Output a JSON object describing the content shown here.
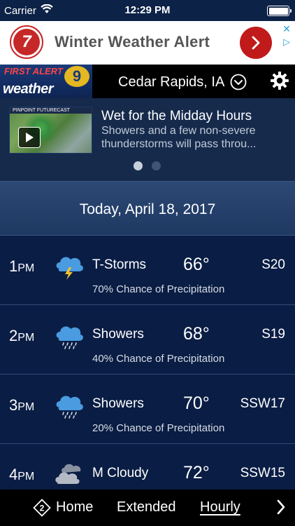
{
  "status_bar": {
    "carrier": "Carrier",
    "time": "12:29 PM"
  },
  "ad": {
    "logo_text": "7",
    "text": "Winter Weather Alert"
  },
  "header": {
    "brand_top": "FIRST ALERT",
    "brand_bottom": "weather",
    "brand_number": "9",
    "location": "Cedar Rapids, IA"
  },
  "news": {
    "title": "Wet for the Midday Hours",
    "body": "Showers and a few non-severe thunderstorms will pass throu...",
    "thumb_caption": "PINPOINT FUTURECAST"
  },
  "date_label": "Today, April 18, 2017",
  "hourly": [
    {
      "hour": "1",
      "period": "PM",
      "icon": "thunderstorm-icon",
      "condition": "T-Storms",
      "temp": "66°",
      "wind": "S20",
      "precip": "70% Chance of Precipitation"
    },
    {
      "hour": "2",
      "period": "PM",
      "icon": "rain-icon",
      "condition": "Showers",
      "temp": "68°",
      "wind": "S19",
      "precip": "40% Chance of Precipitation"
    },
    {
      "hour": "3",
      "period": "PM",
      "icon": "rain-icon",
      "condition": "Showers",
      "temp": "70°",
      "wind": "SSW17",
      "precip": "20% Chance of Precipitation"
    },
    {
      "hour": "4",
      "period": "PM",
      "icon": "cloudy-icon",
      "condition": "M Cloudy",
      "temp": "72°",
      "wind": "SSW15",
      "precip": ""
    }
  ],
  "nav": {
    "home": "Home",
    "extended": "Extended",
    "hourly": "Hourly",
    "home_badge": "2"
  },
  "colors": {
    "background": "#0b1c3c",
    "ad_accent": "#c01a1a",
    "bolt": "#f2c230",
    "cloud_blue": "#4a9be0"
  }
}
